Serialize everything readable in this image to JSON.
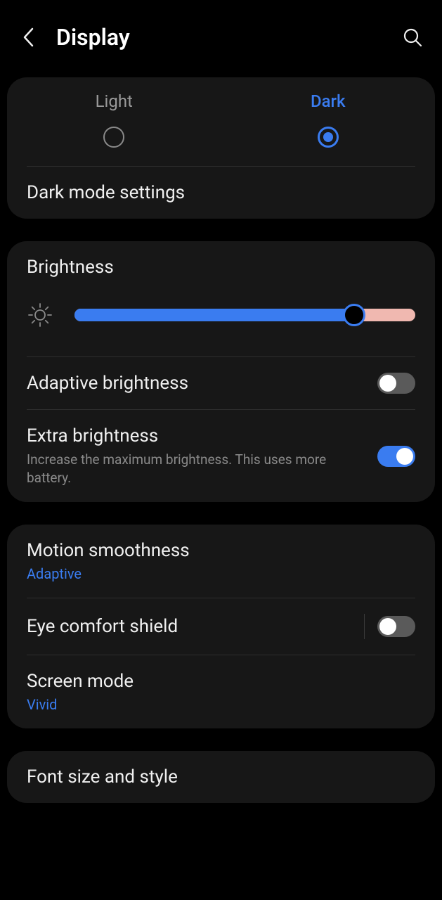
{
  "header": {
    "title": "Display"
  },
  "mode": {
    "light_label": "Light",
    "dark_label": "Dark",
    "dark_mode_settings": "Dark mode settings"
  },
  "brightness": {
    "title": "Brightness",
    "adaptive_label": "Adaptive brightness",
    "extra_label": "Extra brightness",
    "extra_desc": "Increase the maximum brightness. This uses more battery."
  },
  "display_opts": {
    "motion_label": "Motion smoothness",
    "motion_value": "Adaptive",
    "eye_label": "Eye comfort shield",
    "screen_mode_label": "Screen mode",
    "screen_mode_value": "Vivid"
  },
  "font": {
    "label": "Font size and style"
  }
}
